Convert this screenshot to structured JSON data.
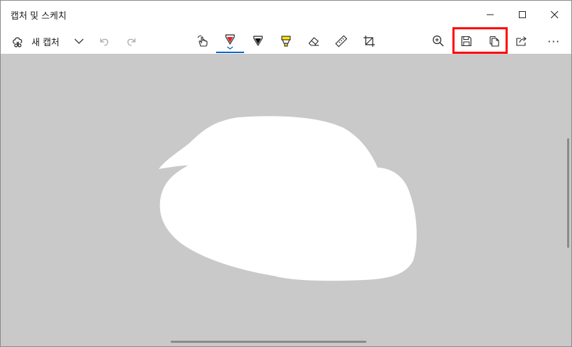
{
  "window": {
    "title": "캡처 및 스케치"
  },
  "toolbar": {
    "new_capture_label": "새 캡처",
    "more_label": "···"
  },
  "colors": {
    "accent": "#0a64c8",
    "highlight": "#ff0000",
    "canvas_bg": "#c9c9c9",
    "pen_red": "#d9262b",
    "highlighter_yellow": "#ffe600"
  },
  "icons": {
    "new_capture": "snip-cloud-icon",
    "dropdown": "chevron-down-icon",
    "undo": "undo-icon",
    "redo": "redo-icon",
    "touch": "touch-writing-icon",
    "ballpoint": "ballpoint-pen-icon",
    "pencil": "pencil-icon",
    "highlighter": "highlighter-icon",
    "eraser": "eraser-icon",
    "ruler": "ruler-icon",
    "crop": "crop-icon",
    "zoom": "zoom-in-icon",
    "save": "save-icon",
    "copy": "copy-icon",
    "share": "share-icon",
    "more": "more-icon"
  }
}
